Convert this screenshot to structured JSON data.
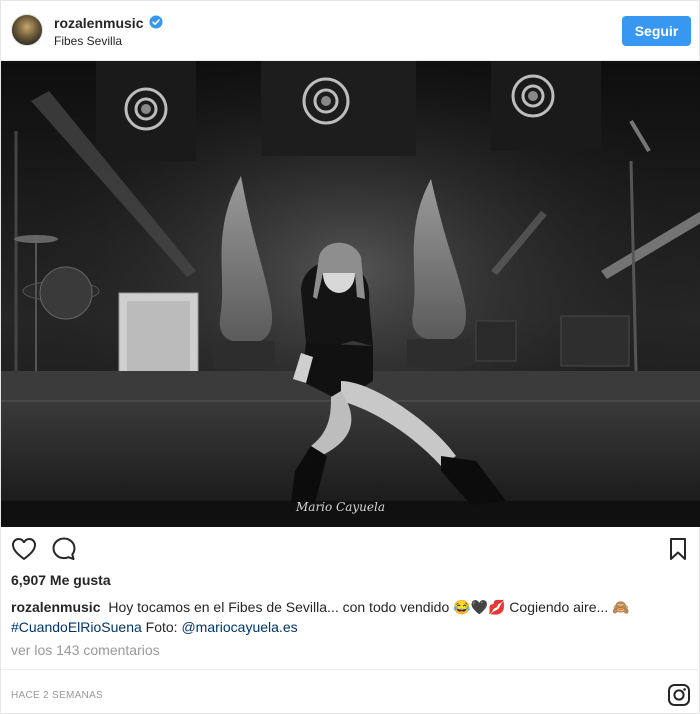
{
  "header": {
    "username": "rozalenmusic",
    "location": "Fibes Sevilla",
    "follow_label": "Seguir",
    "verified_icon": "verified-badge-icon"
  },
  "photo": {
    "watermark": "Mario Cayuela"
  },
  "actions": {
    "like_icon": "heart-icon",
    "comment_icon": "comment-icon",
    "save_icon": "bookmark-icon"
  },
  "likes": {
    "text": "6,907 Me gusta"
  },
  "caption": {
    "user": "rozalenmusic",
    "text": "Hoy tocamos en el Fibes de Sevilla... con todo vendido 😂🖤💋 Cogiendo aire... 🙈",
    "hashtag": "#CuandoElRioSuena",
    "photo_credit_label": "Foto:",
    "mention": "@mariocayuela.es"
  },
  "comments": {
    "view_all": "ver los 143 comentarios"
  },
  "footer": {
    "time_ago": "HACE 2 SEMANAS",
    "brand_icon": "instagram-icon"
  },
  "colors": {
    "accent": "#3897f0",
    "link": "#003569",
    "muted": "#999999"
  }
}
